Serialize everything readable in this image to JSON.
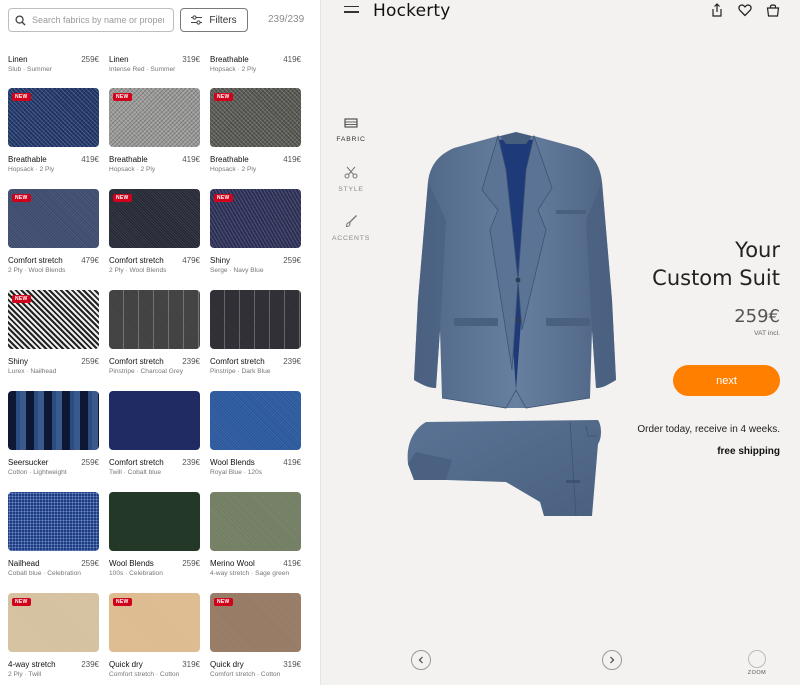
{
  "search": {
    "placeholder": "Search fabrics by name or properties"
  },
  "filters_label": "Filters",
  "result_count": "239/239",
  "new_badge": "NEW",
  "top_row": [
    {
      "name": "Linen",
      "price": "259€",
      "sub": "Slub · Summer"
    },
    {
      "name": "Linen",
      "price": "319€",
      "sub": "Intense Red · Summer"
    },
    {
      "name": "Breathable",
      "price": "419€",
      "sub": "Hopsack · 2 Ply"
    }
  ],
  "fabrics": [
    {
      "name": "Breathable",
      "price": "419€",
      "sub": "Hopsack · 2 Ply",
      "new": true,
      "color": "#233a6e",
      "pattern": "weave"
    },
    {
      "name": "Breathable",
      "price": "419€",
      "sub": "Hopsack · 2 Ply",
      "new": true,
      "color": "#9a9a98",
      "pattern": "weave"
    },
    {
      "name": "Breathable",
      "price": "419€",
      "sub": "Hopsack · 2 Ply",
      "new": true,
      "color": "#5a5a55",
      "pattern": "weave"
    },
    {
      "name": "Comfort stretch",
      "price": "479€",
      "sub": "2 Ply · Wool Blends",
      "new": true,
      "color": "#39476a",
      "pattern": "fine"
    },
    {
      "name": "Comfort stretch",
      "price": "479€",
      "sub": "2 Ply · Wool Blends",
      "new": true,
      "color": "#222632",
      "pattern": "fine"
    },
    {
      "name": "Shiny",
      "price": "259€",
      "sub": "Serge · Navy Blue",
      "new": true,
      "color": "#2c2f55",
      "pattern": "twill"
    },
    {
      "name": "Shiny",
      "price": "259€",
      "sub": "Lurex · Nailhead",
      "new": true,
      "color": "#6f6f6f",
      "pattern": "houndstooth"
    },
    {
      "name": "Comfort stretch",
      "price": "239€",
      "sub": "Pinstripe · Charcoal Grey",
      "new": false,
      "color": "#3e3e3e",
      "pattern": "pinstripe"
    },
    {
      "name": "Comfort stretch",
      "price": "239€",
      "sub": "Pinstripe · Dark Blue",
      "new": false,
      "color": "#2a2a30",
      "pattern": "pinstripe"
    },
    {
      "name": "Seersucker",
      "price": "259€",
      "sub": "Cotton · Lightweight",
      "new": false,
      "color": "#1c2c52",
      "pattern": "stripes"
    },
    {
      "name": "Comfort stretch",
      "price": "239€",
      "sub": "Twill · Cobalt blue",
      "new": false,
      "color": "#202a63",
      "pattern": "plain"
    },
    {
      "name": "Wool Blends",
      "price": "419€",
      "sub": "Royal Blue · 120s",
      "new": false,
      "color": "#26549a",
      "pattern": "fine"
    },
    {
      "name": "Nailhead",
      "price": "259€",
      "sub": "Cobalt blue · Celebration",
      "new": false,
      "color": "#1d3d82",
      "pattern": "dots"
    },
    {
      "name": "Wool Blends",
      "price": "259€",
      "sub": "100s · Celebration",
      "new": false,
      "color": "#233826",
      "pattern": "plain"
    },
    {
      "name": "Merino Wool",
      "price": "419€",
      "sub": "4-way stretch · Sage green",
      "new": false,
      "color": "#6e7a5e",
      "pattern": "fine"
    },
    {
      "name": "4-way stretch",
      "price": "239€",
      "sub": "2 Ply · Twill",
      "new": true,
      "color": "#d4bf9c",
      "pattern": "fine"
    },
    {
      "name": "Quick dry",
      "price": "319€",
      "sub": "Comfort stretch · Cotton",
      "new": true,
      "color": "#ddb98c",
      "pattern": "fine"
    },
    {
      "name": "Quick dry",
      "price": "319€",
      "sub": "Comfort stretch · Cotton",
      "new": true,
      "color": "#93765f",
      "pattern": "fine"
    }
  ],
  "header": {
    "brand": "Hockerty"
  },
  "nav": [
    {
      "label": "FABRIC",
      "icon": "fabric-icon",
      "active": true
    },
    {
      "label": "STYLE",
      "icon": "scissors-icon",
      "active": false
    },
    {
      "label": "ACCENTS",
      "icon": "brush-icon",
      "active": false
    }
  ],
  "product": {
    "headline_1": "Your",
    "headline_2": "Custom Suit",
    "price": "259€",
    "vat": "VAT incl.",
    "next_label": "next",
    "delivery": "Order today, receive in 4 weeks.",
    "shipping": "free shipping",
    "zoom_label": "ZOOM"
  },
  "colors": {
    "accent": "#ff7f00",
    "badge": "#d0021b",
    "suit": "#5f7898"
  }
}
